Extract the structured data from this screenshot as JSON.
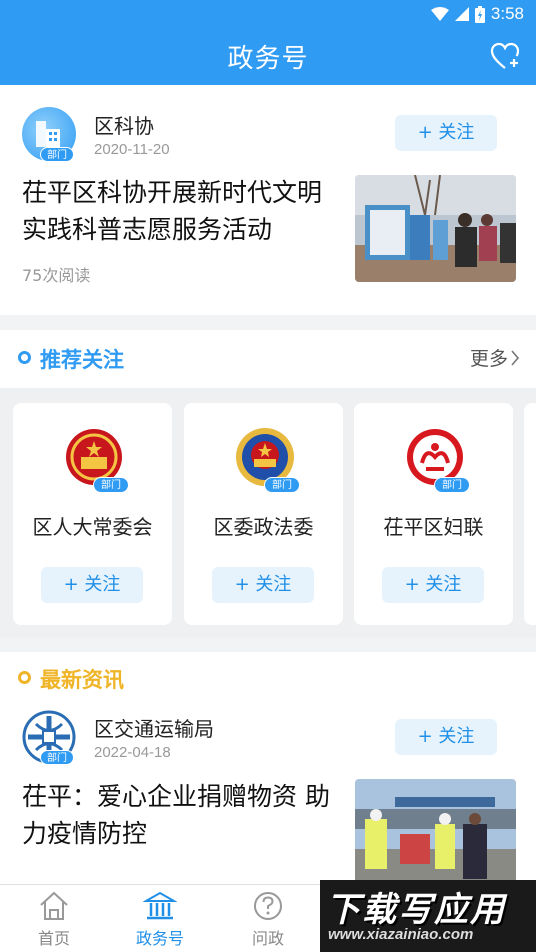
{
  "statusbar": {
    "time": "3:58"
  },
  "header": {
    "title": "政务号"
  },
  "featured": {
    "account": "区科协",
    "date": "2020-11-20",
    "follow": "+ 关注",
    "badge": "部门",
    "headline_line1": "茌平区科协开展新时代文明",
    "headline_line2": "实践科普志愿服务活动",
    "reads": "75次阅读"
  },
  "recommend": {
    "title": "推荐关注",
    "more": "更多",
    "items": [
      {
        "name": "区人大常委会",
        "badge": "部门",
        "follow": "+ 关注"
      },
      {
        "name": "区委政法委",
        "badge": "部门",
        "follow": "+ 关注"
      },
      {
        "name": "茌平区妇联",
        "badge": "部门",
        "follow": "+ 关注"
      }
    ]
  },
  "latest": {
    "title": "最新资讯",
    "account": "区交通运输局",
    "date": "2022-04-18",
    "follow": "+ 关注",
    "badge": "部门",
    "headline_line1": "茌平：爱心企业捐赠物资 助",
    "headline_line2": "力疫情防控"
  },
  "nav": {
    "items": [
      {
        "label": "首页"
      },
      {
        "label": "政务号"
      },
      {
        "label": "问政"
      }
    ]
  },
  "watermark": {
    "main": "下载写应用",
    "url": "www.xiazainiao.com"
  },
  "colors": {
    "primary": "#2f9bf3",
    "accent_yellow": "#f0b429",
    "follow_bg": "#e6f3fd"
  }
}
